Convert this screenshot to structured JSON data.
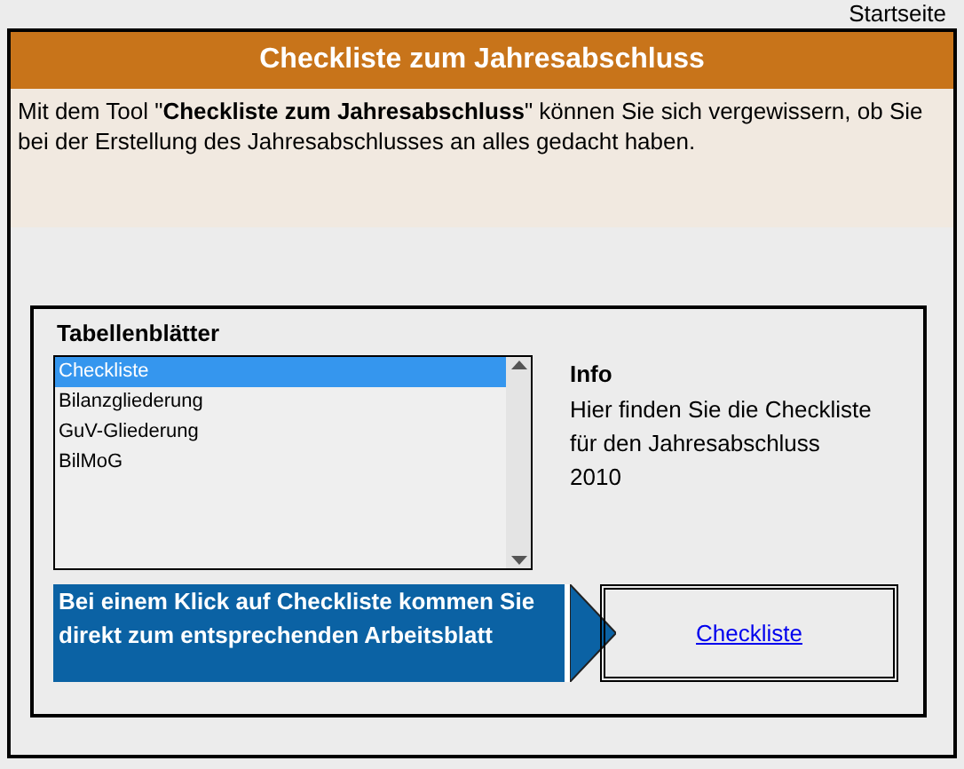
{
  "top_link": "Startseite",
  "header": {
    "title": "Checkliste zum Jahresabschluss",
    "intro": "Mit dem Tool \"**Checkliste zum Jahresabschluss**\" können Sie sich vergewissern, ob Sie bei der Erstellung des Jahresabschlusses an alles gedacht haben."
  },
  "sheets": {
    "title": "Tabellenblätter",
    "items": [
      {
        "label": "Checkliste",
        "selected": true
      },
      {
        "label": "Bilanzgliederung",
        "selected": false
      },
      {
        "label": "GuV-Gliederung",
        "selected": false
      },
      {
        "label": "BilMoG",
        "selected": false
      }
    ]
  },
  "info": {
    "title": "Info",
    "text": "Hier finden Sie die Checkliste für den Jahresabschluss 2010"
  },
  "hint": "Bei einem Klick auf Checkliste kommen Sie direkt zum entsprechenden Arbeitsblatt",
  "link": "Checkliste"
}
